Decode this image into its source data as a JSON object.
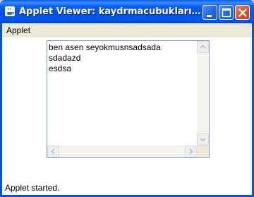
{
  "window": {
    "title": "Applet Viewer: kaydrmacubukları/New...",
    "icon": "java-cup-icon"
  },
  "menubar": {
    "items": [
      "Applet"
    ]
  },
  "textarea": {
    "content": "ben asen seyokmusnsadsada\nsdadazd\nesdsa"
  },
  "status": {
    "text": "Applet started."
  },
  "colors": {
    "titlebar": "#0054e3",
    "close_button": "#d8542e",
    "menubar": "#ece9d8"
  }
}
